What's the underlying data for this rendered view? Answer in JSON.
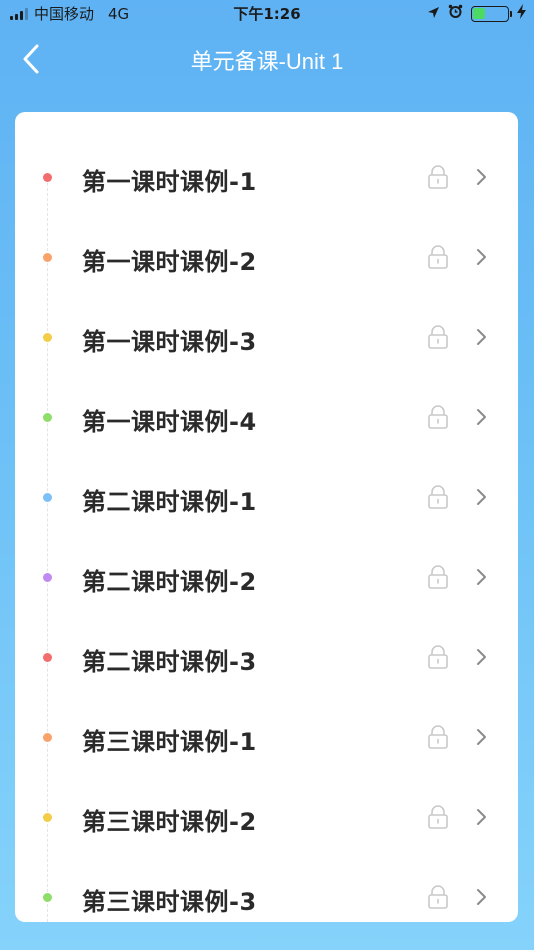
{
  "status_bar": {
    "carrier": "中国移动",
    "network": "4G",
    "time": "下午1:26",
    "battery_level": 0.35,
    "icons": [
      "location-arrow-icon",
      "alarm-clock-icon",
      "battery-icon",
      "charging-bolt-icon"
    ]
  },
  "nav": {
    "title": "单元备课-Unit 1",
    "back_icon": "chevron-left-icon"
  },
  "lessons": [
    {
      "label": "第一课时课例-1",
      "dot_color": "#f26d6d",
      "locked": true
    },
    {
      "label": "第一课时课例-2",
      "dot_color": "#f7a36a",
      "locked": true
    },
    {
      "label": "第一课时课例-3",
      "dot_color": "#f3cd48",
      "locked": true
    },
    {
      "label": "第一课时课例-4",
      "dot_color": "#8fdd6a",
      "locked": true
    },
    {
      "label": "第二课时课例-1",
      "dot_color": "#7cc0f7",
      "locked": true
    },
    {
      "label": "第二课时课例-2",
      "dot_color": "#c08af0",
      "locked": true
    },
    {
      "label": "第二课时课例-3",
      "dot_color": "#f26d6d",
      "locked": true
    },
    {
      "label": "第三课时课例-1",
      "dot_color": "#f7a36a",
      "locked": true
    },
    {
      "label": "第三课时课例-2",
      "dot_color": "#f3cd48",
      "locked": true
    },
    {
      "label": "第三课时课例-3",
      "dot_color": "#8fdd6a",
      "locked": true
    }
  ],
  "colors": {
    "header_gradient_top": "#5fb2f3",
    "header_gradient_bottom": "#85d3fb",
    "lock_gray": "#c9c9c9",
    "chevron_gray": "#8a8a8a"
  }
}
